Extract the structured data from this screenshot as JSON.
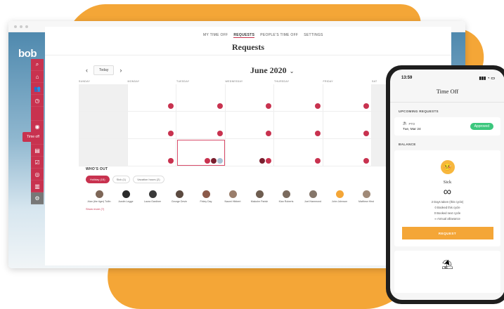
{
  "browser": {
    "logo": "bob"
  },
  "sidebar": {
    "timeoff_label": "Time off",
    "icons": [
      "search-icon",
      "home-icon",
      "people-icon",
      "clock-icon",
      "time-off-icon",
      "eye-icon",
      "badge-icon",
      "docs-icon",
      "tasks-icon",
      "goals-icon",
      "analytics-icon",
      "settings-icon"
    ]
  },
  "topnav": [
    "MY TIME OFF",
    "REQUESTS",
    "PEOPLE'S TIME OFF",
    "SETTINGS"
  ],
  "page_title": "Requests",
  "calendar": {
    "today_label": "Today",
    "month_label": "June 2020",
    "days": [
      "SUNDAY",
      "MONDAY",
      "TUESDAY",
      "WEDNESDAY",
      "THURSDAY",
      "FRIDAY",
      "SAT"
    ]
  },
  "whos_out": {
    "title": "WHO'S OUT",
    "filters": [
      "Holiday (15)",
      "Sick (1)",
      "Vacation hours (2)"
    ],
    "people": [
      {
        "name": "Alan (the tiger) Tullin"
      },
      {
        "name": "Austin Legge"
      },
      {
        "name": "Laura Gardiner"
      },
      {
        "name": "George Devin"
      },
      {
        "name": "Finley Day"
      },
      {
        "name": "Naomi Hibbert"
      },
      {
        "name": "Malcolm Parish"
      },
      {
        "name": "Kian Roberts"
      },
      {
        "name": "Joel Hammond"
      },
      {
        "name": "John Johnson"
      },
      {
        "name": "Matthew Hirst"
      }
    ],
    "show_more": "Show more (7)"
  },
  "phone": {
    "time": "13:59",
    "title": "Time Off",
    "upcoming_label": "UPCOMING REQUESTS",
    "request": {
      "type": "PTO",
      "date": "Tue, Mar 24",
      "status": "Approved"
    },
    "balance_label": "BALANCE",
    "balance": {
      "policy": "Sick",
      "symbol": "∞",
      "stats": [
        "2 Days taken (this cycle)",
        "0 Booked this cycle",
        "0 Booked next cycle",
        "∞ Annual allowance"
      ],
      "button": "REQUEST"
    }
  },
  "colors": {
    "brand": "#c8324f",
    "accent": "#f4a637",
    "approved": "#3cc77d"
  }
}
